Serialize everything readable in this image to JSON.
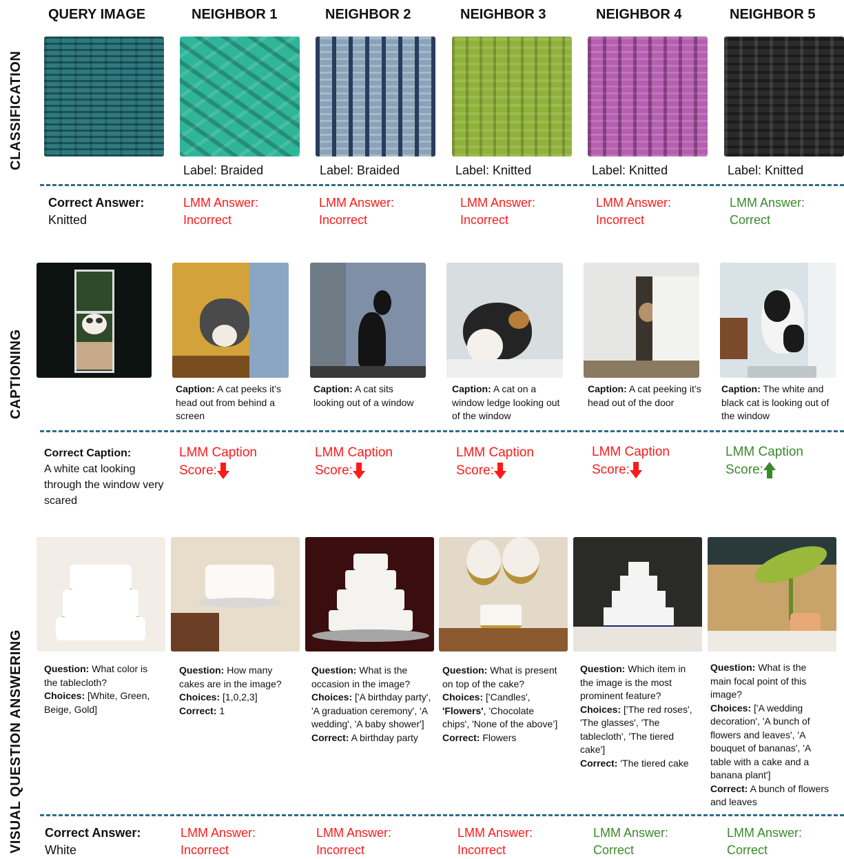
{
  "headers": [
    "QUERY IMAGE",
    "NEIGHBOR 1",
    "NEIGHBOR 2",
    "NEIGHBOR 3",
    "NEIGHBOR 4",
    "NEIGHBOR 5"
  ],
  "sections": {
    "classification": "CLASSIFICATION",
    "captioning": "CAPTIONING",
    "vqa": "VISUAL QUESTION ANSWERING"
  },
  "classification": {
    "labels": [
      "Label: Braided",
      "Label: Braided",
      "Label: Knitted",
      "Label: Knitted",
      "Label: Knitted"
    ],
    "correct_title": "Correct Answer:",
    "correct_value": "Knitted",
    "answers": [
      {
        "line1": "LMM Answer:",
        "line2": "Incorrect"
      },
      {
        "line1": "LMM Answer:",
        "line2": "Incorrect"
      },
      {
        "line1": "LMM Answer:",
        "line2": "Incorrect"
      },
      {
        "line1": "LMM Answer:",
        "line2": "Incorrect"
      },
      {
        "line1": "LMM Answer:",
        "line2": "Correct"
      }
    ]
  },
  "captioning": {
    "caption_key": "Caption:",
    "captions": [
      "A cat peeks it’s head out from behind a screen",
      "A cat sits looking out of a window",
      "A cat on a window ledge looking out of the window",
      "A cat peeking it’s head out of the door",
      "The white and black cat is looking out of the window"
    ],
    "correct_title": "Correct Caption:",
    "correct_value": "A white cat looking through the window very scared",
    "scores": [
      {
        "line1": "LMM Caption",
        "line2": "Score:"
      },
      {
        "line1": "LMM Caption",
        "line2": "Score:"
      },
      {
        "line1": "LMM Caption",
        "line2": "Score:"
      },
      {
        "line1": "LMM Caption",
        "line2": "Score:"
      },
      {
        "line1": "LMM Caption",
        "line2": "Score:"
      }
    ]
  },
  "vqa": {
    "question_key": "Question:",
    "choices_key": "Choices:",
    "correct_key": "Correct:",
    "items": [
      {
        "question": "What color is the tablecloth?",
        "choices": "[White, Green, Beige, Gold]",
        "correct": ""
      },
      {
        "question": "How many cakes are in the image?",
        "choices": "[1,0,2,3]",
        "correct": "1"
      },
      {
        "question": "What is the occasion in the image?",
        "choices": "['A birthday party', 'A graduation ceremony', 'A wedding', 'A baby shower']",
        "correct": "A birthday party"
      },
      {
        "question": "What is present on top of the cake?",
        "choices_pre": "['Candles', ",
        "choices_bold": "'Flowers'",
        "choices_post": ", 'Chocolate chips', 'None of the above’]",
        "correct": "Flowers"
      },
      {
        "question": "Which item in the image is the most prominent feature?",
        "choices": "['The red roses', 'The glasses', 'The tablecloth', 'The tiered cake']",
        "correct": "'The tiered cake"
      },
      {
        "question": "What is the main focal point of this image?",
        "choices": "['A wedding decoration', 'A bunch of flowers and leaves', 'A bouquet of bananas', 'A table with a cake and a banana plant']",
        "correct": "A bunch of flowers and leaves"
      }
    ],
    "correct_title": "Correct Answer:",
    "correct_value": "White",
    "answers": [
      {
        "line1": "LMM Answer:",
        "line2": "Incorrect"
      },
      {
        "line1": "LMM Answer:",
        "line2": "Incorrect"
      },
      {
        "line1": "LMM Answer:",
        "line2": "Incorrect"
      },
      {
        "line1": "LMM Answer:",
        "line2": "Correct"
      },
      {
        "line1": "LMM Answer:",
        "line2": "Correct"
      }
    ]
  },
  "colors": {
    "incorrect": "#ff1a1a",
    "correct": "#3a8a2a",
    "divider": "#2f6b8a"
  },
  "icons": {
    "down": "arrow-down-icon",
    "up": "arrow-up-icon"
  }
}
